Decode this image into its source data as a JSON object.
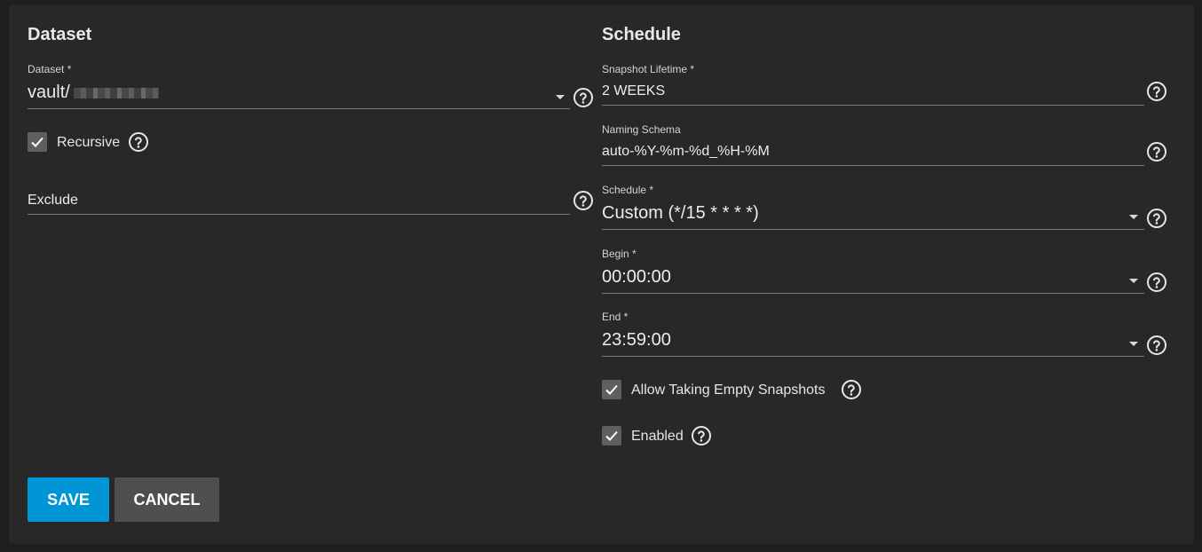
{
  "dataset_section": {
    "title": "Dataset",
    "dataset": {
      "label": "Dataset *",
      "value": "vault/"
    },
    "recursive": {
      "label": "Recursive",
      "checked": true
    },
    "exclude": {
      "label": "Exclude"
    }
  },
  "schedule_section": {
    "title": "Schedule",
    "snapshot_lifetime": {
      "label": "Snapshot Lifetime *",
      "value": "2 WEEKS"
    },
    "naming_schema": {
      "label": "Naming Schema",
      "value": "auto-%Y-%m-%d_%H-%M"
    },
    "schedule": {
      "label": "Schedule *",
      "value": "Custom (*/15 * * * *)"
    },
    "begin": {
      "label": "Begin *",
      "value": "00:00:00"
    },
    "end": {
      "label": "End *",
      "value": "23:59:00"
    },
    "allow_empty": {
      "label": "Allow Taking Empty Snapshots",
      "checked": true
    },
    "enabled": {
      "label": "Enabled",
      "checked": true
    }
  },
  "actions": {
    "save_label": "SAVE",
    "cancel_label": "CANCEL"
  },
  "colors": {
    "accent": "#0095d5",
    "card_bg": "#282828",
    "page_bg": "#1e1e1e",
    "checkbox_bg": "#5f5f5f"
  },
  "icons": {
    "help": "help-circle-icon",
    "check": "check-icon",
    "dropdown": "caret-down-icon"
  }
}
